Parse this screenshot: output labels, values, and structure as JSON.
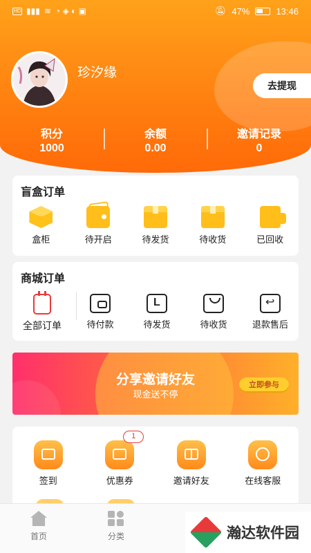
{
  "status_bar": {
    "time": "13:46",
    "battery": "47%"
  },
  "profile": {
    "username": "珍汐缘",
    "withdraw_label": "去提现"
  },
  "stats": [
    {
      "label": "积分",
      "value": "1000"
    },
    {
      "label": "余额",
      "value": "0.00"
    },
    {
      "label": "邀请记录",
      "value": "0"
    }
  ],
  "blind_box": {
    "title": "盲盒订单",
    "items": [
      {
        "label": "盒柜",
        "icon": "cube-icon"
      },
      {
        "label": "待开启",
        "icon": "open-box-icon"
      },
      {
        "label": "待发货",
        "icon": "box-icon"
      },
      {
        "label": "待收货",
        "icon": "package-icon"
      },
      {
        "label": "已回收",
        "icon": "truck-icon"
      }
    ]
  },
  "mall": {
    "title": "商城订单",
    "all_label": "全部订单",
    "items": [
      {
        "label": "待付款",
        "icon": "wallet-icon"
      },
      {
        "label": "待发货",
        "icon": "ship-box-icon"
      },
      {
        "label": "待收货",
        "icon": "bag-icon"
      },
      {
        "label": "退款售后",
        "icon": "return-icon"
      }
    ]
  },
  "banner": {
    "title": "分享邀请好友",
    "subtitle": "现金送不停",
    "button": "立即参与"
  },
  "services": {
    "items": [
      {
        "label": "签到",
        "icon": "checkin-icon"
      },
      {
        "label": "优惠券",
        "icon": "coupon-icon",
        "badge": "1"
      },
      {
        "label": "邀请好友",
        "icon": "gift-icon"
      },
      {
        "label": "在线客服",
        "icon": "customer-service-icon"
      }
    ]
  },
  "tabbar": {
    "items": [
      {
        "label": "首页",
        "icon": "home-icon"
      },
      {
        "label": "分类",
        "icon": "category-icon"
      }
    ]
  },
  "watermark": {
    "text": "瀚达软件园"
  },
  "colors": {
    "header_orange": "#ff8a12",
    "accent_yellow": "#ffbe1a",
    "banner_pink": "#ff2f6c"
  }
}
